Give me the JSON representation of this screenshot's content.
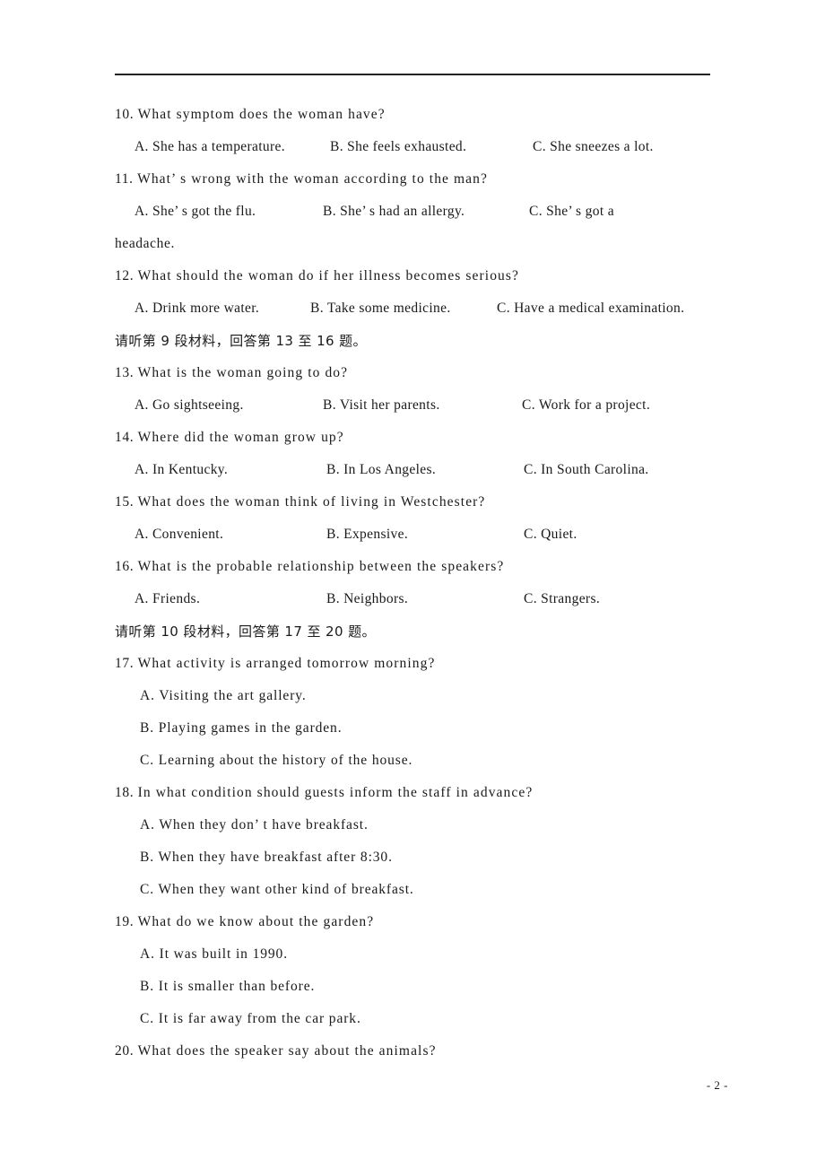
{
  "document": {
    "page_number_label": "- 2 -",
    "text_color": "#1a1a1a",
    "rule_color": "#222222",
    "background_color": "#ffffff"
  },
  "blocks": [
    {
      "id": "q10",
      "kind": "question",
      "number": "10.",
      "stem": "What symptom does the woman have?",
      "options_inline": [
        "A. She has a temperature.",
        "B. She feels exhausted.",
        "C. She sneezes a lot."
      ]
    },
    {
      "id": "q11",
      "kind": "question",
      "number": "11.",
      "stem": "What’ s wrong with the woman according to the man?",
      "options_inline": [
        "A. She’ s got the flu.",
        "B. She’ s had an allergy.",
        "C. She’ s got a"
      ],
      "continuation": "headache."
    },
    {
      "id": "q12",
      "kind": "question",
      "number": "12.",
      "stem": "What should the woman do if her illness becomes serious?",
      "options_inline": [
        "A. Drink more water.",
        "B. Take some medicine.",
        "C. Have a medical examination."
      ]
    },
    {
      "id": "cn1",
      "kind": "directive",
      "text": "请听第 9 段材料，回答第 13 至 16 题。"
    },
    {
      "id": "q13",
      "kind": "question",
      "number": "13.",
      "stem": "What is the woman going to do?",
      "options_inline": [
        "A. Go sightseeing.",
        "B. Visit her parents.",
        "C. Work for a project."
      ]
    },
    {
      "id": "q14",
      "kind": "question",
      "number": "14.",
      "stem": "Where did the woman grow up?",
      "options_inline": [
        "A. In Kentucky.",
        "B. In Los Angeles.",
        "C. In South Carolina."
      ]
    },
    {
      "id": "q15",
      "kind": "question",
      "number": "15.",
      "stem": "What does the woman think of living in Westchester?",
      "options_inline": [
        "A. Convenient.",
        "B. Expensive.",
        "C. Quiet."
      ]
    },
    {
      "id": "q16",
      "kind": "question",
      "number": "16.",
      "stem": "What is the probable relationship between the speakers?",
      "options_inline": [
        "A. Friends.",
        "B. Neighbors.",
        "C. Strangers."
      ]
    },
    {
      "id": "cn2",
      "kind": "directive",
      "text": "请听第 10 段材料，回答第 17 至 20 题。"
    },
    {
      "id": "q17",
      "kind": "question",
      "number": "17.",
      "stem": "What activity is arranged tomorrow morning?",
      "options_stacked": [
        "A. Visiting the art gallery.",
        "B. Playing games in the garden.",
        "C. Learning about the history of the house."
      ]
    },
    {
      "id": "q18",
      "kind": "question",
      "number": "18.",
      "stem": "In what condition should guests inform the staff in advance?",
      "options_stacked": [
        "A. When they don’ t have breakfast.",
        "B. When they have breakfast after 8:30.",
        "C. When they want other kind of breakfast."
      ]
    },
    {
      "id": "q19",
      "kind": "question",
      "number": "19.",
      "stem": "What do we know about the garden?",
      "options_stacked": [
        "A. It was built in 1990.",
        "B. It is smaller than before.",
        "C. It is far away from the car park."
      ]
    },
    {
      "id": "q20",
      "kind": "question",
      "number": "20.",
      "stem": "What does the speaker say about the animals?",
      "options_stacked": []
    }
  ]
}
